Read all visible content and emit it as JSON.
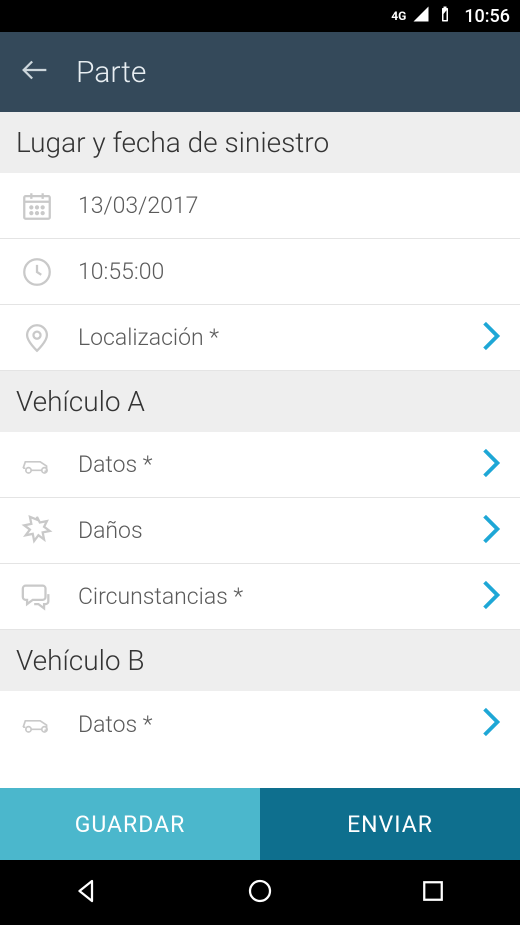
{
  "status": {
    "network": "4G",
    "time": "10:56"
  },
  "appbar": {
    "title": "Parte"
  },
  "sections": {
    "lugar": {
      "header": "Lugar y fecha de siniestro",
      "date": "13/03/2017",
      "time": "10:55:00",
      "location": "Localización *"
    },
    "vehA": {
      "header": "Vehículo A",
      "datos": "Datos *",
      "danos": "Daños",
      "circ": "Circunstancias *"
    },
    "vehB": {
      "header": "Vehículo B",
      "datos": "Datos *"
    }
  },
  "actions": {
    "save": "GUARDAR",
    "send": "ENVIAR"
  }
}
